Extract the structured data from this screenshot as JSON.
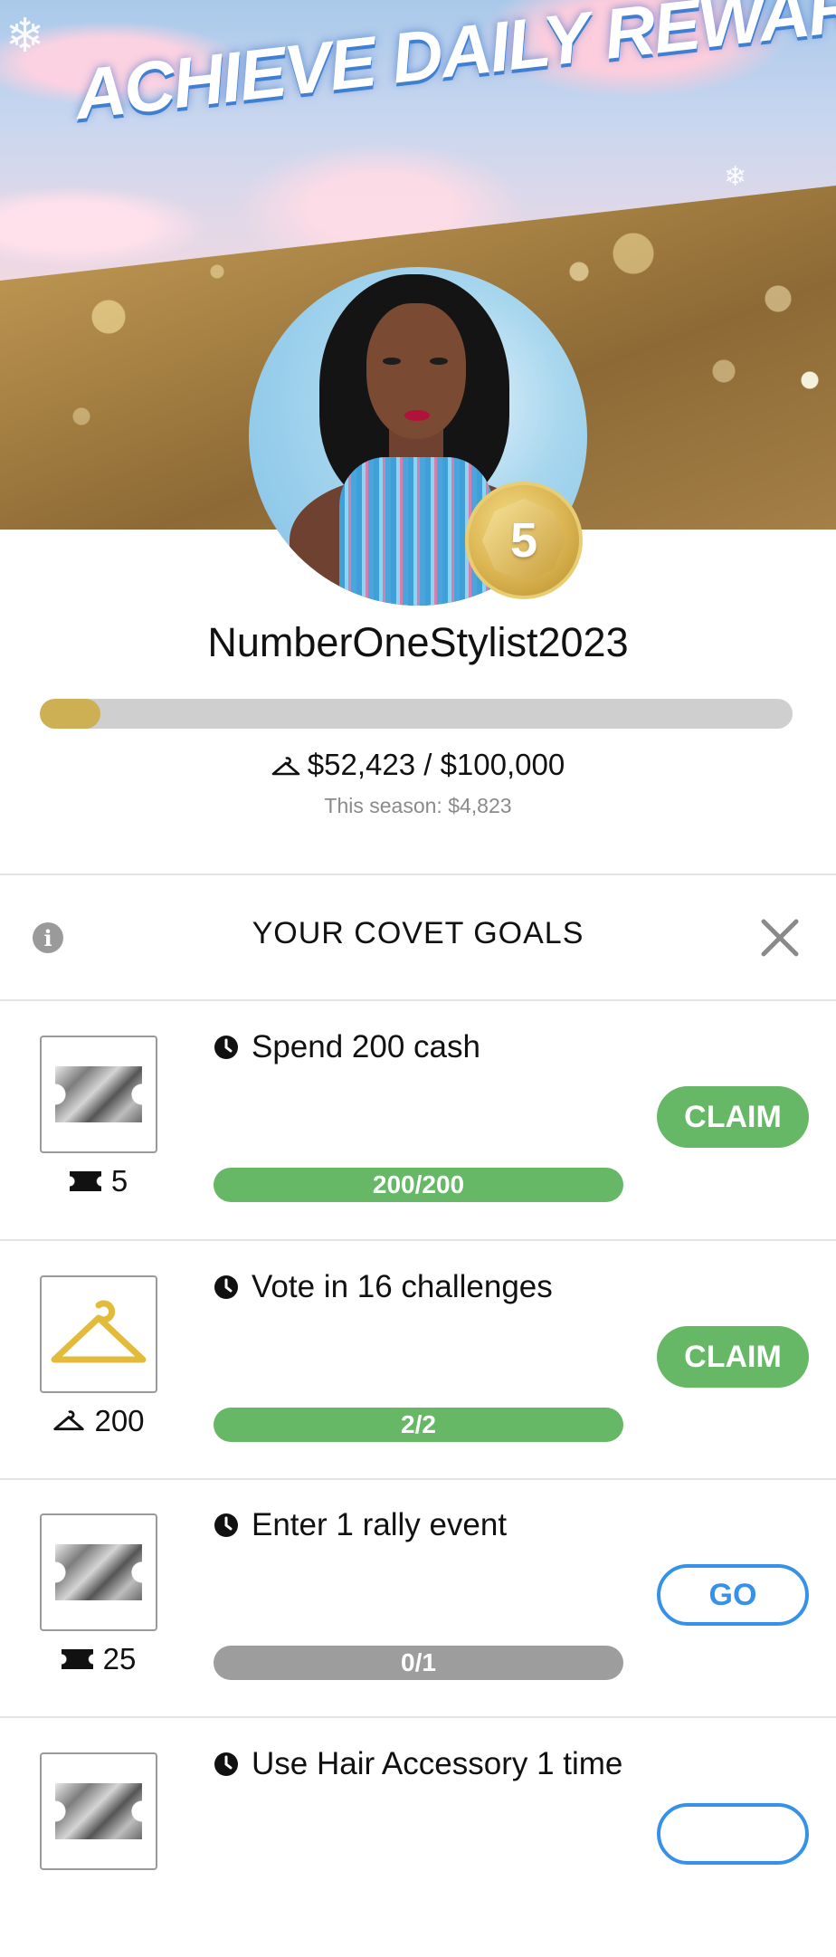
{
  "banner": {
    "headline": "ACHIEVE DAILY REWARDS"
  },
  "profile": {
    "level": "5",
    "username": "NumberOneStylist2023",
    "progress_fraction": 0.08,
    "balance_text": "$52,423 / $100,000",
    "season_text": "This season: $4,823"
  },
  "goals_panel": {
    "title": "YOUR COVET GOALS",
    "info_icon": "info-icon",
    "close_icon": "close-icon"
  },
  "goals": [
    {
      "reward_icon": "ticket-icon",
      "reward_amount": "5",
      "description": "Spend 200 cash",
      "progress_text": "200/200",
      "status": "complete",
      "button_label": "CLAIM"
    },
    {
      "reward_icon": "hanger-icon",
      "reward_amount": "200",
      "description": "Vote in 16 challenges",
      "progress_text": "2/2",
      "status": "complete",
      "button_label": "CLAIM"
    },
    {
      "reward_icon": "ticket-icon",
      "reward_amount": "25",
      "description": "Enter 1 rally event",
      "progress_text": "0/1",
      "status": "incomplete",
      "button_label": "GO"
    },
    {
      "reward_icon": "ticket-icon",
      "description": "Use Hair Accessory 1 time"
    }
  ],
  "colors": {
    "claim_green": "#66b866",
    "go_blue": "#3592e8",
    "gold": "#cdb053"
  }
}
